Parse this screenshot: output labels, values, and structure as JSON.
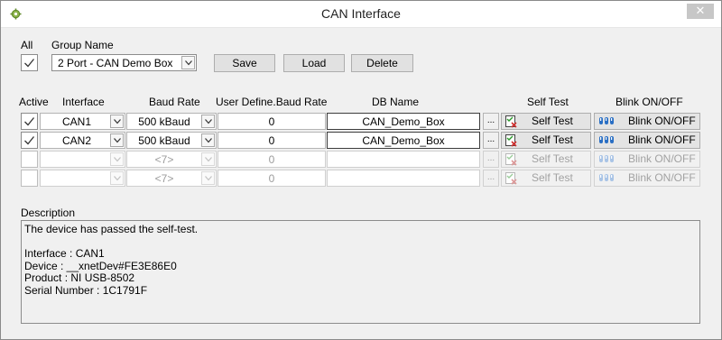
{
  "window": {
    "title": "CAN Interface",
    "close_glyph": "✕"
  },
  "group": {
    "all_label": "All",
    "all_checked": true,
    "group_name_label": "Group Name",
    "group_name_value": "2 Port - CAN Demo Box",
    "save_label": "Save",
    "load_label": "Load",
    "delete_label": "Delete"
  },
  "table": {
    "headers": {
      "active": "Active",
      "interface": "Interface",
      "baud_rate": "Baud Rate",
      "user_baud": "User Define.Baud Rate",
      "db_name": "DB Name",
      "self_test": "Self Test",
      "blink": "Blink ON/OFF"
    },
    "ellipsis_label": "...",
    "rows": [
      {
        "active": true,
        "enabled": true,
        "interface": "CAN1",
        "baud_rate": "500 kBaud",
        "user_baud": "0",
        "db_name": "CAN_Demo_Box",
        "self_test": "Self Test",
        "blink": "Blink ON/OFF"
      },
      {
        "active": true,
        "enabled": true,
        "interface": "CAN2",
        "baud_rate": "500 kBaud",
        "user_baud": "0",
        "db_name": "CAN_Demo_Box",
        "self_test": "Self Test",
        "blink": "Blink ON/OFF"
      },
      {
        "active": false,
        "enabled": false,
        "interface": "",
        "baud_rate": "<7>",
        "user_baud": "0",
        "db_name": "",
        "self_test": "Self Test",
        "blink": "Blink ON/OFF"
      },
      {
        "active": false,
        "enabled": false,
        "interface": "",
        "baud_rate": "<7>",
        "user_baud": "0",
        "db_name": "",
        "self_test": "Self Test",
        "blink": "Blink ON/OFF"
      }
    ]
  },
  "description": {
    "label": "Description",
    "lines": [
      "The device has passed the self-test.",
      "",
      "Interface : CAN1",
      "Device : __xnetDev#FE3E86E0",
      "Product : NI USB-8502",
      "Serial Number : 1C1791F"
    ]
  },
  "icons": {
    "app": "gear-icon",
    "self_test": "checklist-icon",
    "blink": "led-icon",
    "dropdown": "chevron-down-icon",
    "check": "check-icon"
  }
}
